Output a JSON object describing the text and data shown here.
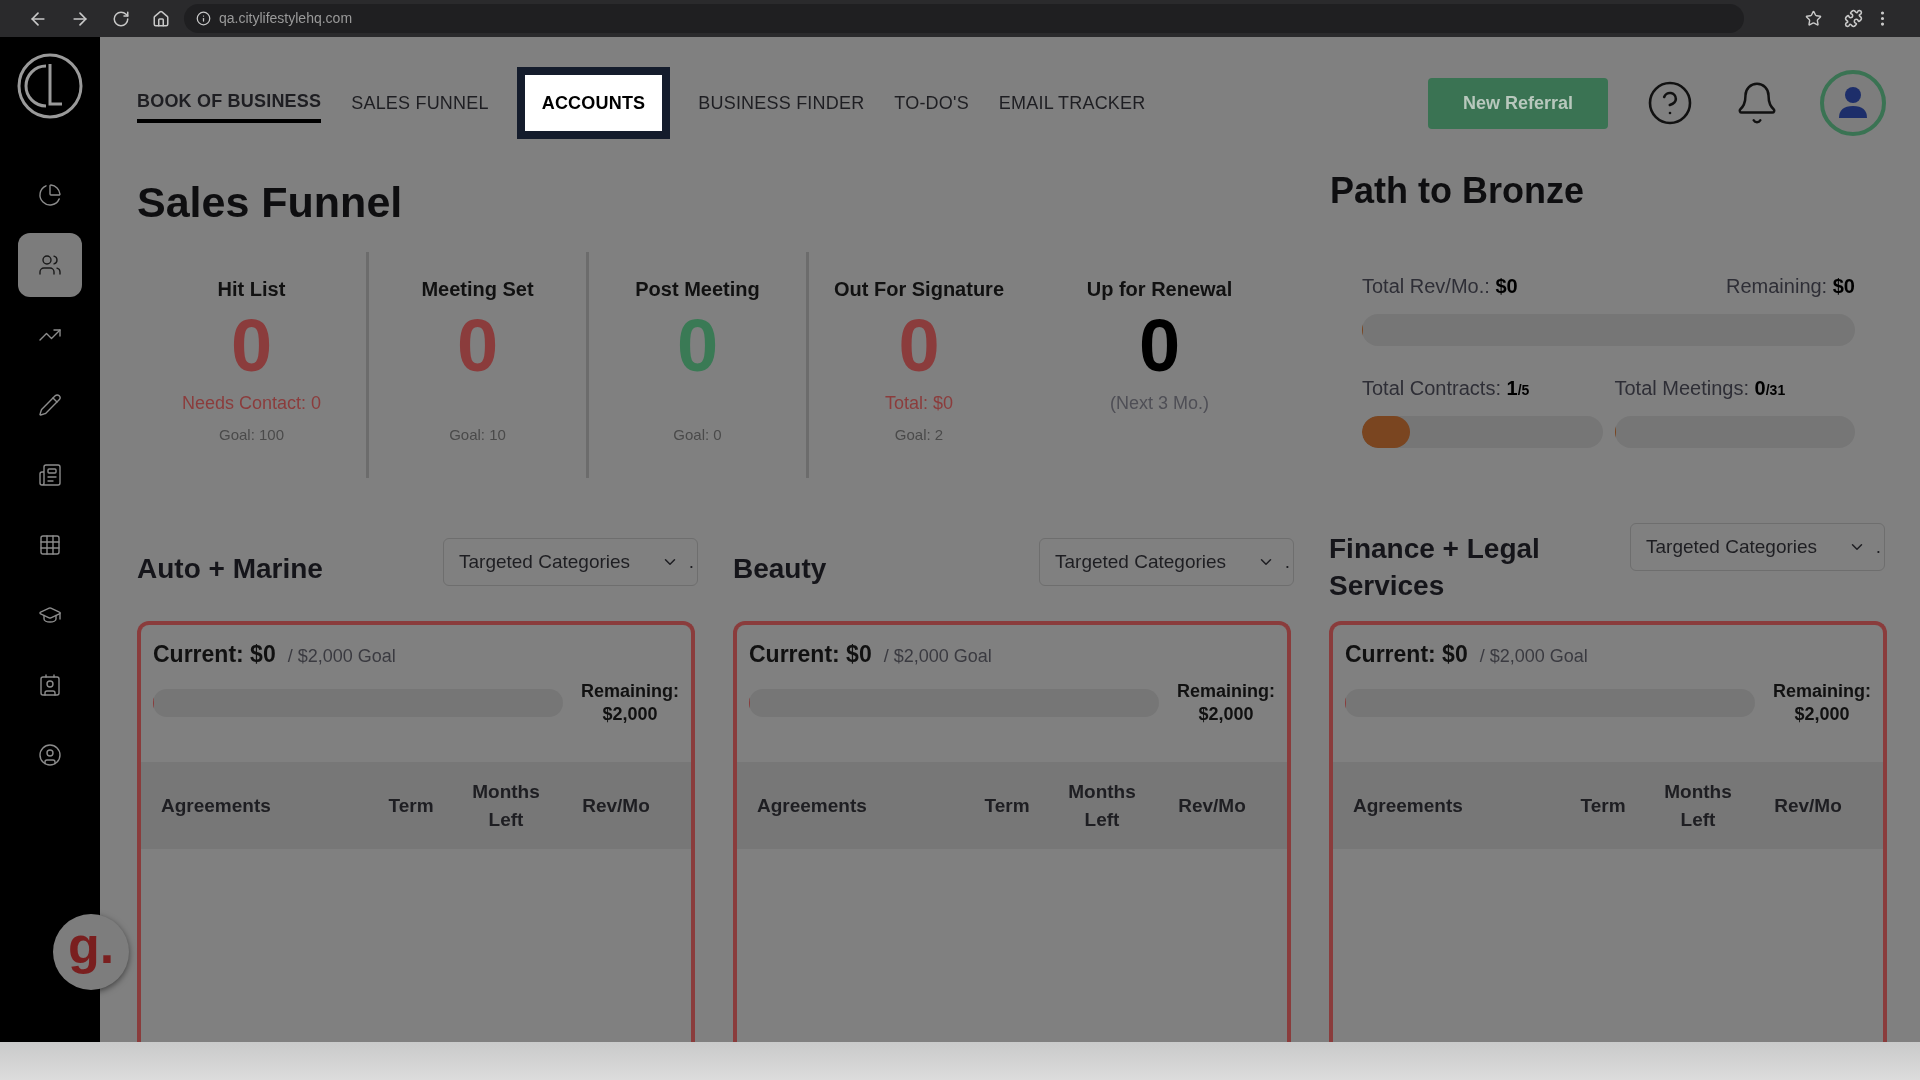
{
  "browser": {
    "url": "qa.citylifestylehq.com"
  },
  "sidebar": {
    "items": [
      {
        "selected": false
      },
      {
        "selected": true
      },
      {
        "selected": false
      },
      {
        "selected": false
      },
      {
        "selected": false
      },
      {
        "selected": false
      },
      {
        "selected": false
      },
      {
        "selected": false
      },
      {
        "selected": false
      }
    ]
  },
  "chat_widget": {
    "label": "g."
  },
  "tabs": [
    {
      "label": "BOOK OF BUSINESS",
      "selected": true,
      "highlighted": false
    },
    {
      "label": "SALES FUNNEL",
      "selected": false,
      "highlighted": false
    },
    {
      "label": "ACCOUNTS",
      "selected": false,
      "highlighted": true
    },
    {
      "label": "BUSINESS FINDER",
      "selected": false,
      "highlighted": false
    },
    {
      "label": "TO-DO'S",
      "selected": false,
      "highlighted": false
    },
    {
      "label": "EMAIL TRACKER",
      "selected": false,
      "highlighted": false
    }
  ],
  "header_button": "New Referral",
  "sales_funnel": {
    "title": "Sales Funnel",
    "stages": [
      {
        "label": "Hit List",
        "value": "0",
        "color": "#8b3c3c",
        "sub": {
          "text": "Needs Contact: 0",
          "color": "#8b3c3c"
        },
        "goal": "Goal: 100"
      },
      {
        "label": "Meeting Set",
        "value": "0",
        "color": "#8b3c3c",
        "goal": "Goal: 10"
      },
      {
        "label": "Post Meeting",
        "value": "0",
        "color": "#3a7a55",
        "goal": "Goal: 0"
      },
      {
        "label": "Out For Signature",
        "value": "0",
        "color": "#8b3c3c",
        "sub": {
          "text": "Total: $0",
          "color": "#8b3c3c"
        },
        "goal": "Goal: 2"
      },
      {
        "label": "Up for Renewal",
        "value": "0",
        "color": "#000000",
        "sub": {
          "text": "(Next 3 Mo.)",
          "color": "#4e4e55"
        }
      }
    ]
  },
  "path": {
    "title": "Path to Bronze",
    "revenue": {
      "label": "Total Rev/Mo.:",
      "value": "$0",
      "level": 0
    },
    "remaining": {
      "label": "Remaining:",
      "value": "$0"
    },
    "contracts": {
      "label": "Total Contracts:",
      "value": "1",
      "of": "/5",
      "level": 0.2
    },
    "meetings": {
      "label": "Total Meetings:",
      "value": "0",
      "of": "/31",
      "level": 0
    }
  },
  "categories": [
    {
      "title": "Auto + Marine",
      "dropdown": "Targeted Categories",
      "suffix": ".",
      "current": "Current: $0",
      "goal": "/ $2,000 Goal",
      "level": 0,
      "remaining_label": "Remaining:",
      "remaining_value": "$2,000",
      "columns": [
        "Agreements",
        "Term",
        "Months Left",
        "Rev/Mo"
      ]
    },
    {
      "title": "Beauty",
      "dropdown": "Targeted Categories",
      "suffix": ".",
      "current": "Current: $0",
      "goal": "/ $2,000 Goal",
      "level": 0,
      "remaining_label": "Remaining:",
      "remaining_value": "$2,000",
      "columns": [
        "Agreements",
        "Term",
        "Months Left",
        "Rev/Mo"
      ]
    },
    {
      "title": "Finance + Legal Services",
      "dropdown": "Targeted Categories",
      "suffix": ".",
      "current": "Current: $0",
      "goal": "/ $2,000 Goal",
      "level": 0,
      "remaining_label": "Remaining:",
      "remaining_value": "$2,000",
      "columns": [
        "Agreements",
        "Term",
        "Months Left",
        "Rev/Mo"
      ]
    }
  ]
}
